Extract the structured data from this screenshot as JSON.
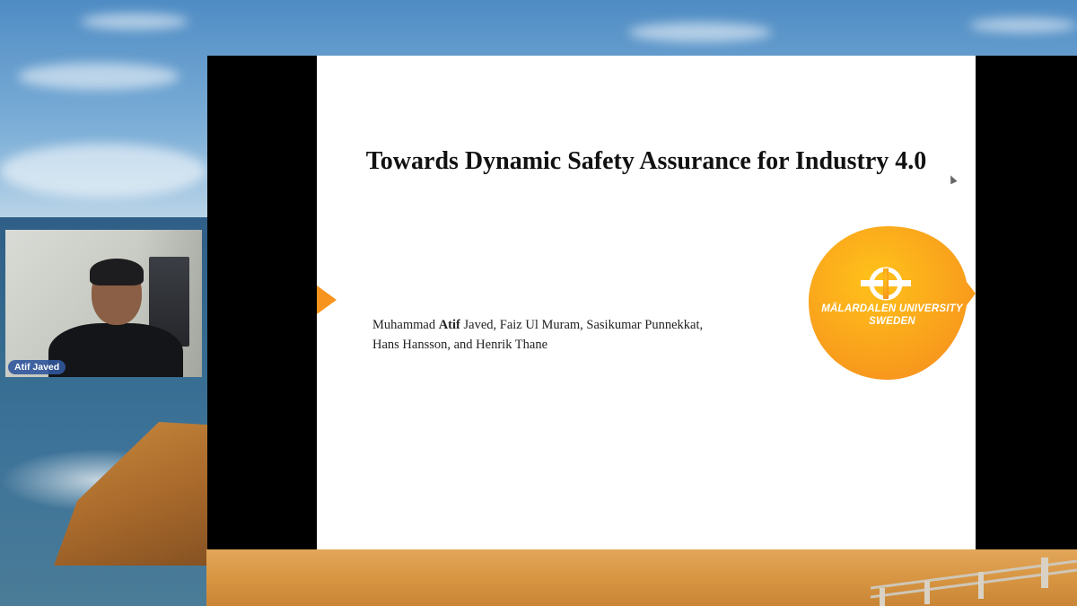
{
  "slide": {
    "title": "Towards Dynamic Safety Assurance for Industry 4.0",
    "authors_line1_pre": "Muhammad ",
    "authors_line1_bold": "Atif",
    "authors_line1_post": " Javed, Faiz Ul Muram, Sasikumar Punnekkat,",
    "authors_line2": "Hans Hansson, and Henrik Thane",
    "logo": {
      "line1": "MÄLARDALEN UNIVERSITY",
      "line2": "SWEDEN",
      "color": "#f7941d"
    },
    "accent_color": "#f7941d"
  },
  "participant": {
    "name": "Atif Javed",
    "icon": "webcam-video"
  }
}
